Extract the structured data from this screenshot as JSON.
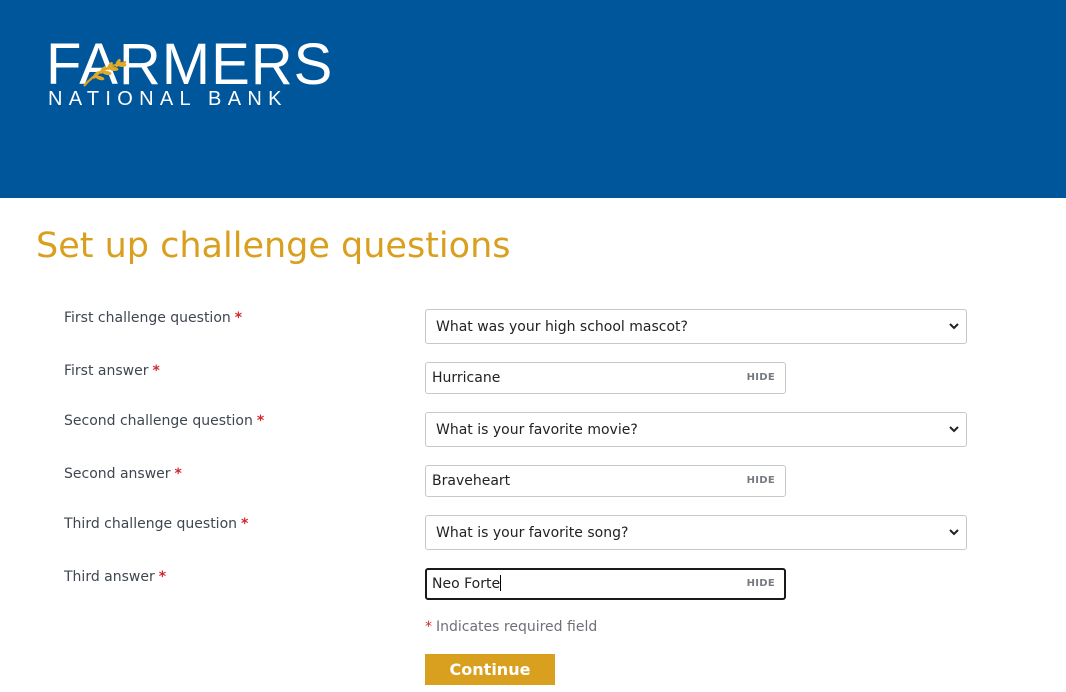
{
  "brand": {
    "name_top": "FARMERS",
    "name_bottom": "NATIONAL BANK",
    "header_color": "#00569b",
    "accent_color": "#d9a01f"
  },
  "page": {
    "title": "Set up challenge questions"
  },
  "form": {
    "fields": [
      {
        "label": "First challenge question",
        "type": "select",
        "value": "What was your high school mascot?"
      },
      {
        "label": "First answer",
        "type": "text",
        "value": "Hurricane",
        "toggle": "HIDE"
      },
      {
        "label": "Second challenge question",
        "type": "select",
        "value": "What is your favorite movie?"
      },
      {
        "label": "Second answer",
        "type": "text",
        "value": "Braveheart",
        "toggle": "HIDE"
      },
      {
        "label": "Third challenge question",
        "type": "select",
        "value": "What is your favorite song?"
      },
      {
        "label": "Third answer",
        "type": "text",
        "value": "Neo Forte",
        "toggle": "HIDE",
        "focused": true
      }
    ],
    "required_marker": "*",
    "required_note": "Indicates required field",
    "submit_label": "Continue"
  }
}
